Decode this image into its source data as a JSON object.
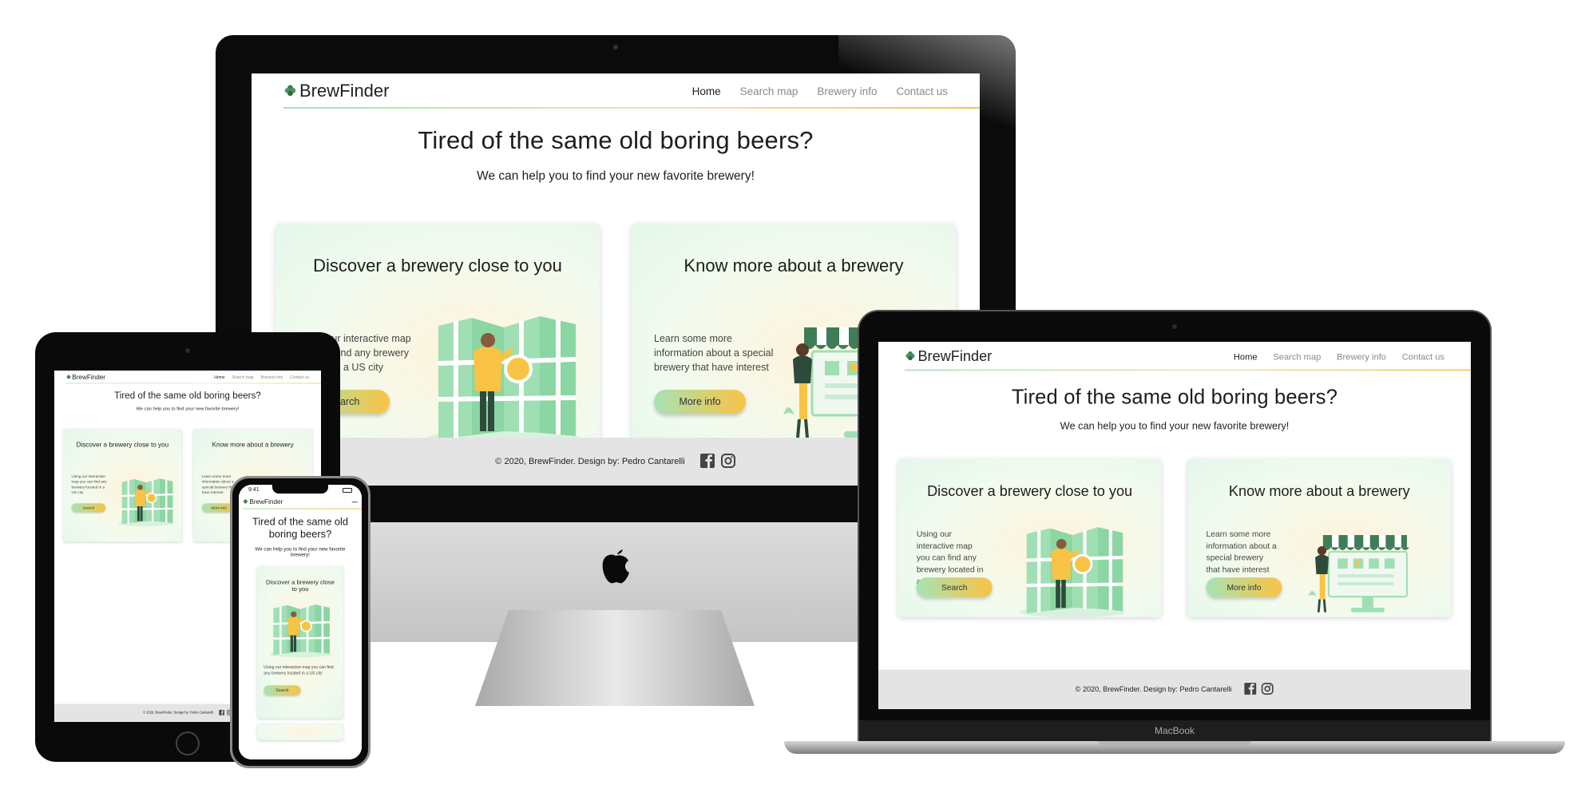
{
  "site": {
    "logo": "BrewFinder",
    "nav": [
      "Home",
      "Search map",
      "Brewery info",
      "Contact us"
    ],
    "hero_title": "Tired of the same old boring beers?",
    "hero_subtitle": "We can help you to find your new favorite brewery!",
    "cards": [
      {
        "title": "Discover a brewery close to you",
        "text": "Using our interactive map you can find any brewery located in a US city",
        "button": "Search",
        "art": "map-illustration"
      },
      {
        "title": "Know more about a brewery",
        "text": "Learn some more information about a special brewery that have interest",
        "button": "More info",
        "art": "storefront-illustration"
      }
    ],
    "footer": "© 2020, BrewFinder. Design by: Pedro Cantarelli",
    "social_icons": [
      "facebook-icon",
      "instagram-icon"
    ]
  },
  "devices": {
    "laptop_brand": "MacBook",
    "phone_time": "9:41"
  },
  "colors": {
    "accent_green": "#a6e3b3",
    "accent_yellow": "#f9c346",
    "footer_bg": "#e4e4e4",
    "device_frame": "#0a0a0a"
  }
}
